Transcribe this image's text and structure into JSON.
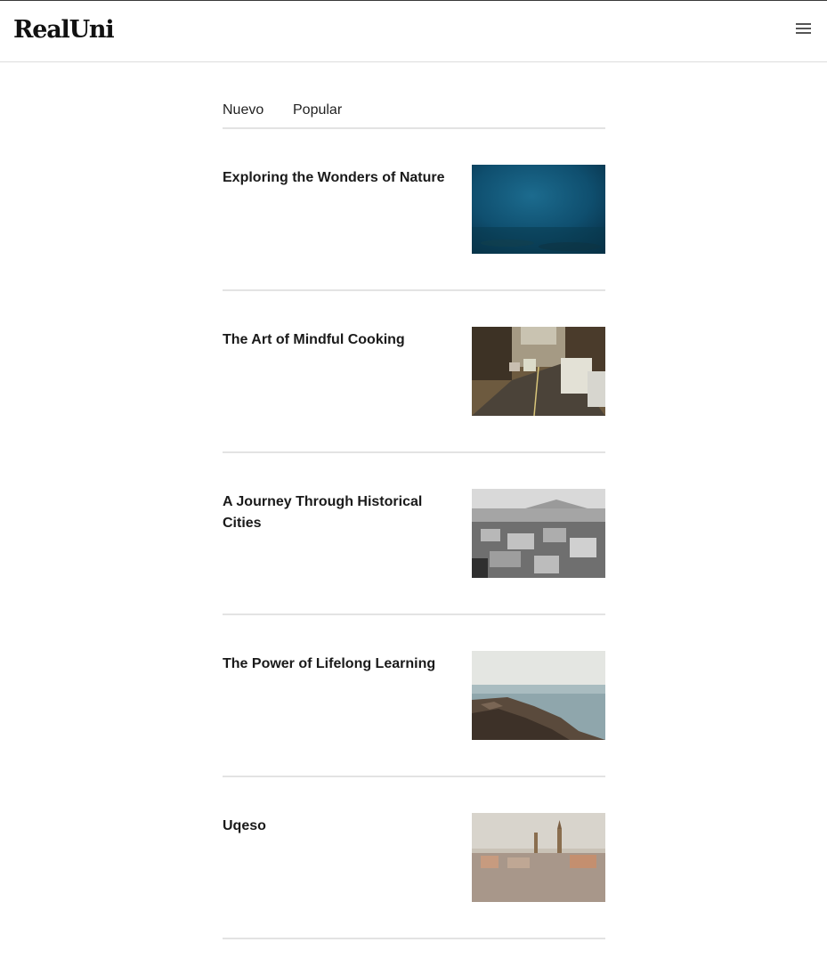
{
  "header": {
    "logo": "RealUni",
    "menu_icon": "hamburger-menu-icon"
  },
  "tabs": [
    {
      "label": "Nuevo"
    },
    {
      "label": "Popular"
    }
  ],
  "articles": [
    {
      "title": "Exploring the Wonders of Nature",
      "image": "underwater-photo"
    },
    {
      "title": "The Art of Mindful Cooking",
      "image": "city-street-traffic-photo"
    },
    {
      "title": "A Journey Through Historical Cities",
      "image": "black-and-white-city-aerial-photo"
    },
    {
      "title": "The Power of Lifelong Learning",
      "image": "rocky-seashore-photo"
    },
    {
      "title": "Uqeso",
      "image": "city-skyline-photo"
    }
  ]
}
